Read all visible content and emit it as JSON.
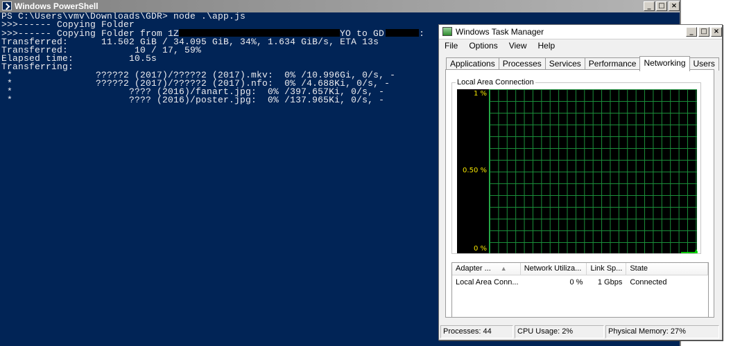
{
  "powershell": {
    "title": "Windows PowerShell",
    "console_lines": [
      "PS C:\\Users\\vmv\\Downloads\\GDR> node .\\app.js",
      ">>>------ Copying Folder",
      ">>>------ Copying Folder from 1Z",
      "Transferred:      11.502 GiB / 34.095 GiB, 34%, 1.634 GiB/s, ETA 13s",
      "Transferred:            10 / 17, 59%",
      "Elapsed time:          10.5s",
      "Transferring:",
      " *               ?????2 (2017)/?????2 (2017).mkv:  0% /10.996Gi, 0/s, -",
      " *               ?????2 (2017)/?????2 (2017).nfo:  0% /4.688Ki, 0/s, -",
      " *                     ???? (2016)/fanart.jpg:  0% /397.657Ki, 0/s, -",
      " *                     ???? (2016)/poster.jpg:  0% /137.965Ki, 0/s, -"
    ],
    "copy_from_mid": "YO to GD",
    "copy_from_end": ":"
  },
  "taskmanager": {
    "title": "Windows Task Manager",
    "menu": [
      "File",
      "Options",
      "View",
      "Help"
    ],
    "tabs": [
      "Applications",
      "Processes",
      "Services",
      "Performance",
      "Networking",
      "Users"
    ],
    "active_tab": "Networking",
    "group_label": "Local Area Connection",
    "axis_labels": {
      "top": "1 %",
      "mid": "0.50 %",
      "bottom": "0 %"
    },
    "table": {
      "columns": [
        "Adapter ...",
        "Network Utiliza...",
        "Link Sp...",
        "State"
      ],
      "rows": [
        {
          "adapter": "Local Area Conn...",
          "utilization": "0 %",
          "link_speed": "1 Gbps",
          "state": "Connected"
        }
      ]
    },
    "status": {
      "processes": "Processes: 44",
      "cpu": "CPU Usage: 2%",
      "memory": "Physical Memory: 27%"
    },
    "graph_color": "#00ff00",
    "grid_color": "#1a8f3a",
    "axis_label_color": "#f5e600"
  },
  "colors": {
    "console_bg": "#012456",
    "console_fg": "#eeedf0"
  }
}
